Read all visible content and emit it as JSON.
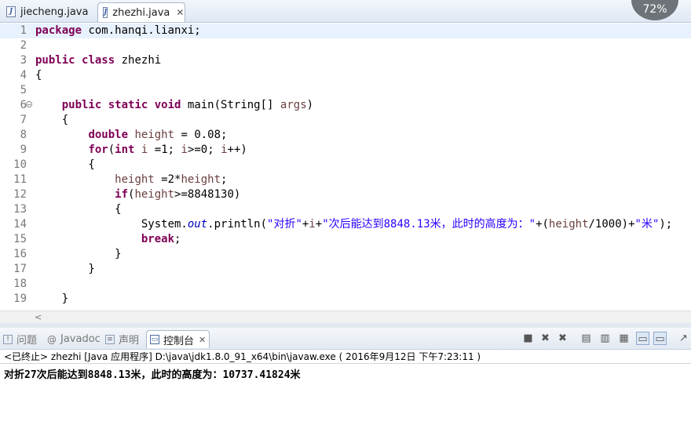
{
  "editor_tabs": [
    {
      "label": "jiecheng.java",
      "active": false
    },
    {
      "label": "zhezhi.java",
      "active": true
    }
  ],
  "zoom_badge": "72%",
  "code_lines": [
    {
      "n": "1",
      "tokens": [
        [
          "kw",
          "package"
        ],
        [
          "t",
          " com.hanqi.lianxi;"
        ]
      ]
    },
    {
      "n": "2",
      "tokens": []
    },
    {
      "n": "3",
      "tokens": [
        [
          "kw",
          "public"
        ],
        [
          "t",
          " "
        ],
        [
          "kw",
          "class"
        ],
        [
          "t",
          " zhezhi"
        ]
      ]
    },
    {
      "n": "4",
      "tokens": [
        [
          "t",
          "{"
        ]
      ]
    },
    {
      "n": "5",
      "tokens": []
    },
    {
      "n": "6",
      "tokens": [
        [
          "t",
          "    "
        ],
        [
          "kw",
          "public"
        ],
        [
          "t",
          " "
        ],
        [
          "kw",
          "static"
        ],
        [
          "t",
          " "
        ],
        [
          "kw",
          "void"
        ],
        [
          "t",
          " main(String[] "
        ],
        [
          "var",
          "args"
        ],
        [
          "t",
          ")"
        ]
      ]
    },
    {
      "n": "7",
      "tokens": [
        [
          "t",
          "    {"
        ]
      ]
    },
    {
      "n": "8",
      "tokens": [
        [
          "t",
          "        "
        ],
        [
          "kw",
          "double"
        ],
        [
          "t",
          " "
        ],
        [
          "var",
          "height"
        ],
        [
          "t",
          " = 0.08;"
        ]
      ]
    },
    {
      "n": "9",
      "tokens": [
        [
          "t",
          "        "
        ],
        [
          "kw",
          "for"
        ],
        [
          "t",
          "("
        ],
        [
          "kw",
          "int"
        ],
        [
          "t",
          " "
        ],
        [
          "var",
          "i"
        ],
        [
          "t",
          " =1; "
        ],
        [
          "var",
          "i"
        ],
        [
          "t",
          ">=0; "
        ],
        [
          "var",
          "i"
        ],
        [
          "t",
          "++)"
        ]
      ]
    },
    {
      "n": "10",
      "tokens": [
        [
          "t",
          "        {"
        ]
      ]
    },
    {
      "n": "11",
      "tokens": [
        [
          "t",
          "            "
        ],
        [
          "var",
          "height"
        ],
        [
          "t",
          " =2*"
        ],
        [
          "var",
          "height"
        ],
        [
          "t",
          ";"
        ]
      ]
    },
    {
      "n": "12",
      "tokens": [
        [
          "t",
          "            "
        ],
        [
          "kw",
          "if"
        ],
        [
          "t",
          "("
        ],
        [
          "var",
          "height"
        ],
        [
          "t",
          ">=8848130)"
        ]
      ]
    },
    {
      "n": "13",
      "tokens": [
        [
          "t",
          "            {"
        ]
      ]
    },
    {
      "n": "14",
      "tokens": [
        [
          "t",
          "                System."
        ],
        [
          "fld",
          "out"
        ],
        [
          "t",
          ".println("
        ],
        [
          "str",
          "\"对折\""
        ],
        [
          "t",
          "+"
        ],
        [
          "var",
          "i"
        ],
        [
          "t",
          "+"
        ],
        [
          "str",
          "\"次后能达到8848.13米，此时的高度为：\""
        ],
        [
          "t",
          "+("
        ],
        [
          "var",
          "height"
        ],
        [
          "t",
          "/1000)+"
        ],
        [
          "str",
          "\"米\""
        ],
        [
          "t",
          ");"
        ]
      ]
    },
    {
      "n": "15",
      "tokens": [
        [
          "t",
          "                "
        ],
        [
          "kw",
          "break"
        ],
        [
          "t",
          ";"
        ]
      ]
    },
    {
      "n": "16",
      "tokens": [
        [
          "t",
          "            }"
        ]
      ]
    },
    {
      "n": "17",
      "tokens": [
        [
          "t",
          "        }"
        ]
      ]
    },
    {
      "n": "18",
      "tokens": []
    },
    {
      "n": "19",
      "tokens": [
        [
          "t",
          "    }"
        ]
      ]
    }
  ],
  "console_tabs": [
    {
      "label": "问题",
      "icon": "problems-icon"
    },
    {
      "label": "Javadoc",
      "icon": "at-icon"
    },
    {
      "label": "声明",
      "icon": "declaration-icon"
    },
    {
      "label": "控制台",
      "icon": "console-icon",
      "active": true
    }
  ],
  "console": {
    "status": "<已终止> zhezhi [Java 应用程序] D:\\java\\jdk1.8.0_91_x64\\bin\\javaw.exe ( 2016年9月12日 下午7:23:11 )",
    "output": "对折27次后能达到8848.13米，此时的高度为：10737.41824米"
  },
  "colors": {
    "keyword": "#7f0055",
    "string": "#2a00ff",
    "field": "#0000c0",
    "current_line": "#e8f2fe"
  }
}
